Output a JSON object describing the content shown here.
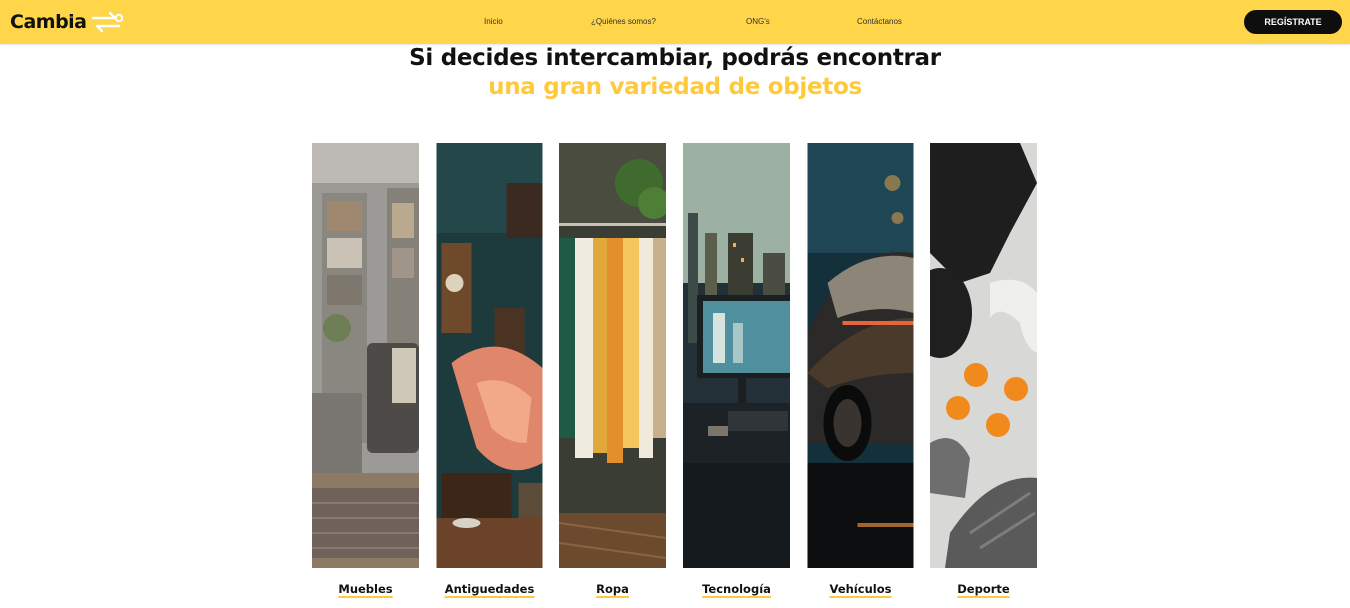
{
  "brand": {
    "name": "Cambia",
    "accent_color": "#ffc93c",
    "navbar_color": "#ffd54a",
    "logo_icon": "exchange-arrows-icon"
  },
  "nav": {
    "links": [
      {
        "label": "Inicio"
      },
      {
        "label": "¿Quiénes somos?"
      },
      {
        "label": "ONG's"
      },
      {
        "label": "Contáctanos"
      }
    ],
    "register_label": "REGÍSTRATE"
  },
  "hero": {
    "line1": "Si decides intercambiar, podrás encontrar",
    "line2": "una gran variedad de objetos"
  },
  "categories": [
    {
      "label": "Muebles",
      "image": "living-room-furniture-photo"
    },
    {
      "label": "Antiguedades",
      "image": "gramophone-antiques-photo"
    },
    {
      "label": "Ropa",
      "image": "clothes-rack-photo"
    },
    {
      "label": "Tecnología",
      "image": "computer-desk-photo"
    },
    {
      "label": "Vehículos",
      "image": "sports-car-photo"
    },
    {
      "label": "Deporte",
      "image": "sports-gear-photo"
    }
  ]
}
